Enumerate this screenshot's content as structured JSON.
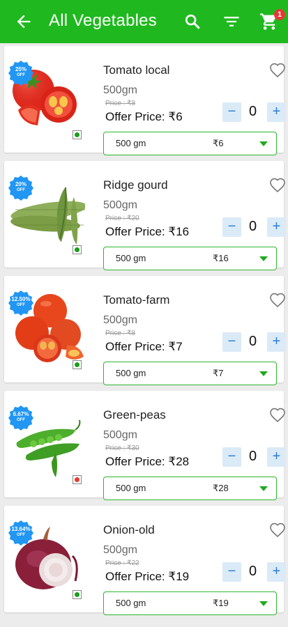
{
  "appbar": {
    "title": "All Vegetables",
    "cart_count": "1",
    "icons": [
      "back-arrow-icon",
      "search-icon",
      "filter-icon",
      "cart-icon"
    ],
    "color": "#1fb91f"
  },
  "products": [
    {
      "name": "Tomato local",
      "discount": "25%",
      "off": "OFF",
      "weight": "500gm",
      "mrp": "Price : ₹8",
      "offer_price": "Offer Price: ₹6",
      "quantity": "0",
      "variant_label": "500 gm",
      "variant_price": "₹6",
      "food_type": "veg",
      "image": "tomato"
    },
    {
      "name": "Ridge gourd",
      "discount": "20%",
      "off": "OFF",
      "weight": "500gm",
      "mrp": "Price : ₹20",
      "offer_price": "Offer Price: ₹16",
      "quantity": "0",
      "variant_label": "500 gm",
      "variant_price": "₹16",
      "food_type": "veg",
      "image": "ridge-gourd"
    },
    {
      "name": "Tomato-farm",
      "discount": "12.50%",
      "off": "OFF",
      "weight": "500gm",
      "mrp": "Price : ₹8",
      "offer_price": "Offer Price: ₹7",
      "quantity": "0",
      "variant_label": "500 gm",
      "variant_price": "₹7",
      "food_type": "veg",
      "image": "tomato-farm"
    },
    {
      "name": "Green-peas",
      "discount": "6.67%",
      "off": "OFF",
      "weight": "500gm",
      "mrp": "Price : ₹30",
      "offer_price": "Offer Price: ₹28",
      "quantity": "0",
      "variant_label": "500 gm",
      "variant_price": "₹28",
      "food_type": "non-veg",
      "image": "green-peas"
    },
    {
      "name": "Onion-old",
      "discount": "13.64%",
      "off": "OFF",
      "weight": "500gm",
      "mrp": "Price : ₹22",
      "offer_price": "Offer Price: ₹19",
      "quantity": "0",
      "variant_label": "500 gm",
      "variant_price": "₹19",
      "food_type": "veg",
      "image": "onion"
    }
  ],
  "qty_controls": {
    "minus": "−",
    "plus": "+"
  },
  "colors": {
    "accent": "#1fb91f",
    "badge": "#2196f3",
    "veg": "#1a9e1a",
    "non_veg": "#e53935",
    "qty_button": "#dbeaf7"
  }
}
